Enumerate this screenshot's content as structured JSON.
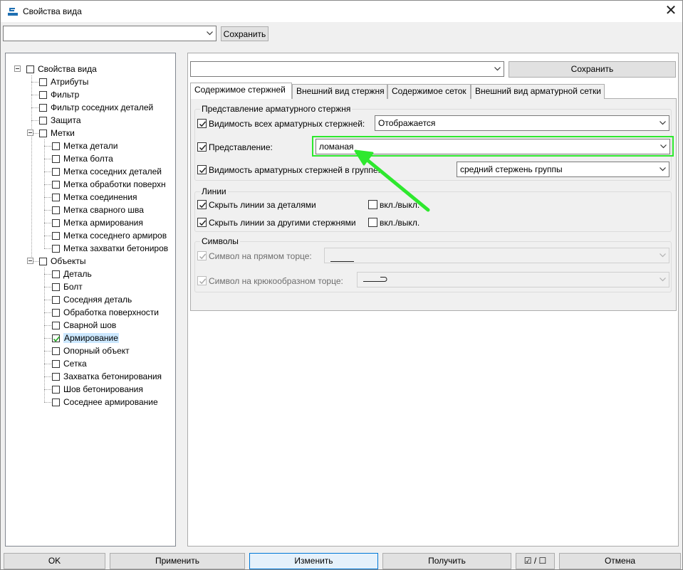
{
  "window": {
    "title": "Свойства вида",
    "close_glyph": "✕",
    "icon": "app-logo-icon"
  },
  "top_bar": {
    "combo_value": "",
    "save_label": "Сохранить"
  },
  "tree": {
    "items": [
      {
        "label": "Свойства вида",
        "checked": false,
        "expanded": true
      },
      {
        "label": "Атрибуты",
        "checked": false
      },
      {
        "label": "Фильтр",
        "checked": false
      },
      {
        "label": "Фильтр соседних деталей",
        "checked": false
      },
      {
        "label": "Защита",
        "checked": false
      },
      {
        "label": "Метки",
        "checked": false,
        "expanded": true
      },
      {
        "label": "Метка детали",
        "checked": false
      },
      {
        "label": "Метка болта",
        "checked": false
      },
      {
        "label": "Метка соседних деталей",
        "checked": false
      },
      {
        "label": "Метка обработки поверхн",
        "checked": false
      },
      {
        "label": "Метка соединения",
        "checked": false
      },
      {
        "label": "Метка сварного шва",
        "checked": false
      },
      {
        "label": "Метка армирования",
        "checked": false
      },
      {
        "label": "Метка соседнего армиров",
        "checked": false
      },
      {
        "label": "Метка захватки бетониров",
        "checked": false
      },
      {
        "label": "Объекты",
        "checked": false,
        "expanded": true
      },
      {
        "label": "Деталь",
        "checked": false
      },
      {
        "label": "Болт",
        "checked": false
      },
      {
        "label": "Соседняя деталь",
        "checked": false
      },
      {
        "label": "Обработка поверхности",
        "checked": false
      },
      {
        "label": "Сварной шов",
        "checked": false
      },
      {
        "label": "Армирование",
        "checked": true,
        "selected": true
      },
      {
        "label": "Опорный объект",
        "checked": false
      },
      {
        "label": "Сетка",
        "checked": false
      },
      {
        "label": "Захватка бетонирования",
        "checked": false
      },
      {
        "label": "Шов бетонирования",
        "checked": false
      },
      {
        "label": "Соседнее армирование",
        "checked": false
      }
    ],
    "scroll_left": "‹",
    "scroll_right": "›"
  },
  "right": {
    "combo_value": "",
    "save_label": "Сохранить",
    "tabs": [
      {
        "label": "Содержимое стержней",
        "active": true
      },
      {
        "label": "Внешний вид стержня",
        "active": false
      },
      {
        "label": "Содержимое сеток",
        "active": false
      },
      {
        "label": "Внешний вид арматурной сетки",
        "active": false
      }
    ],
    "group_representation": {
      "title": "Представление арматурного стержня",
      "visibility_all_label": "Видимость всех арматурных стержней:",
      "visibility_all_checked": true,
      "visibility_all_value": "Отображается",
      "representation_label": "Представление:",
      "representation_checked": true,
      "representation_value": "ломаная",
      "group_visibility_label": "Видимость арматурных стержней в группе:",
      "group_visibility_checked": true,
      "group_visibility_value": "средний стержень группы"
    },
    "group_lines": {
      "title": "Линии",
      "hide_behind_parts_label": "Скрыть линии за деталями",
      "hide_behind_parts_checked": true,
      "hide_behind_bars_label": "Скрыть линии за другими стержнями",
      "hide_behind_bars_checked": true,
      "on_off_1": "вкл./выкл.",
      "on_off_2": "вкл./выкл."
    },
    "group_symbols": {
      "title": "Символы",
      "straight_end_label": "Символ на прямом торце:",
      "hook_end_label": "Символ на крюкообразном торце:"
    }
  },
  "annotation": {
    "color": "#2ee82e"
  },
  "bottom": {
    "ok": "OK",
    "apply": "Применить",
    "modify": "Изменить",
    "get": "Получить",
    "toggle": "☑ / ☐",
    "cancel": "Отмена"
  }
}
